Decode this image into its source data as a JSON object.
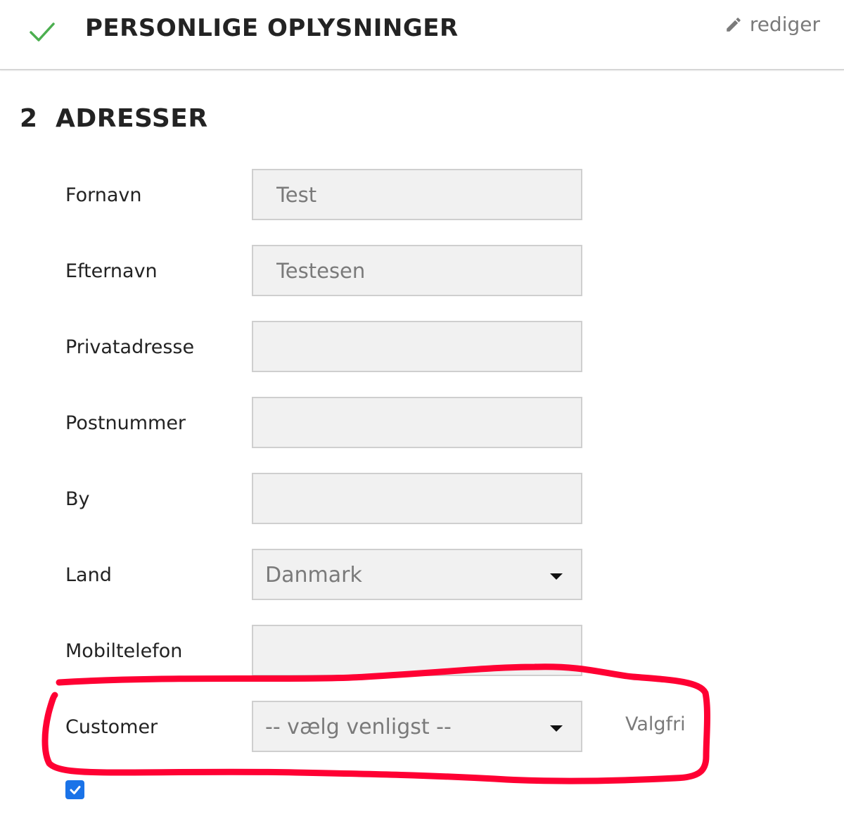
{
  "step1": {
    "title": "PERSONLIGE OPLYSNINGER",
    "edit_label": "rediger",
    "status_icon": "check-icon",
    "edit_icon": "pencil-icon"
  },
  "step2": {
    "number": "2",
    "title": "ADRESSER"
  },
  "fields": {
    "firstname": {
      "label": "Fornavn",
      "value": "Test"
    },
    "lastname": {
      "label": "Efternavn",
      "value": "Testesen"
    },
    "address": {
      "label": "Privatadresse",
      "value": ""
    },
    "postcode": {
      "label": "Postnummer",
      "value": ""
    },
    "city": {
      "label": "By",
      "value": ""
    },
    "country": {
      "label": "Land",
      "value": "Danmark"
    },
    "mobile": {
      "label": "Mobiltelefon",
      "value": ""
    },
    "customer": {
      "label": "Customer",
      "value": "-- vælg venligst --",
      "note": "Valgfri"
    }
  },
  "checkbox": {
    "checked": true
  },
  "colors": {
    "check_green": "#4caf50",
    "annotation_red": "#ff0033",
    "checkbox_blue": "#1a73e8",
    "field_bg": "#f1f1f1"
  }
}
